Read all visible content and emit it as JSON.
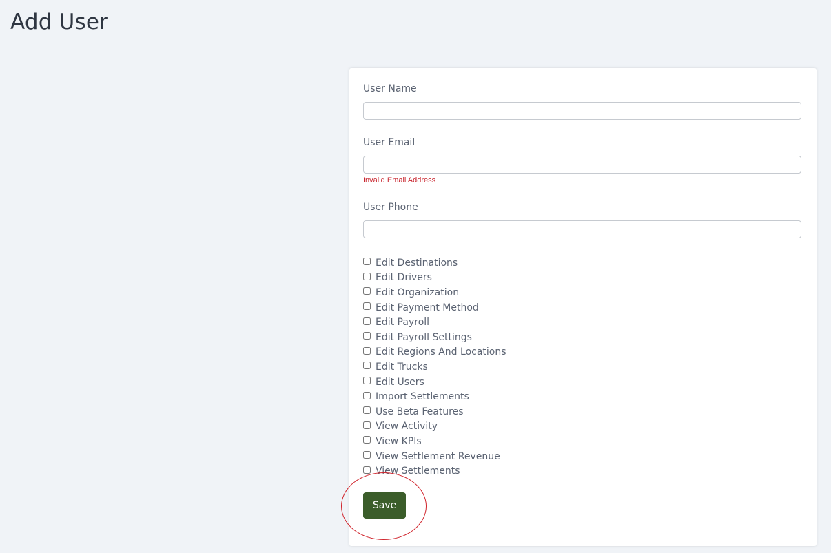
{
  "page": {
    "title": "Add User"
  },
  "form": {
    "user_name": {
      "label": "User Name",
      "value": "",
      "placeholder": ""
    },
    "user_email": {
      "label": "User Email",
      "value": "",
      "placeholder": "",
      "error": "Invalid Email Address"
    },
    "user_phone": {
      "label": "User Phone",
      "value": "",
      "placeholder": ""
    },
    "permissions": [
      {
        "label": "Edit Destinations",
        "checked": false
      },
      {
        "label": "Edit Drivers",
        "checked": false
      },
      {
        "label": "Edit Organization",
        "checked": false
      },
      {
        "label": "Edit Payment Method",
        "checked": false
      },
      {
        "label": "Edit Payroll",
        "checked": false
      },
      {
        "label": "Edit Payroll Settings",
        "checked": false
      },
      {
        "label": "Edit Regions And Locations",
        "checked": false
      },
      {
        "label": "Edit Trucks",
        "checked": false
      },
      {
        "label": "Edit Users",
        "checked": false
      },
      {
        "label": "Import Settlements",
        "checked": false
      },
      {
        "label": "Use Beta Features",
        "checked": false
      },
      {
        "label": "View Activity",
        "checked": false
      },
      {
        "label": "View KPIs",
        "checked": false
      },
      {
        "label": "View Settlement Revenue",
        "checked": false
      },
      {
        "label": "View Settlements",
        "checked": false
      }
    ],
    "save_label": "Save"
  },
  "colors": {
    "background": "#f0f3f7",
    "card": "#ffffff",
    "save_button": "#3b5d2a",
    "error": "#c8232c",
    "highlight": "#d0232b"
  }
}
